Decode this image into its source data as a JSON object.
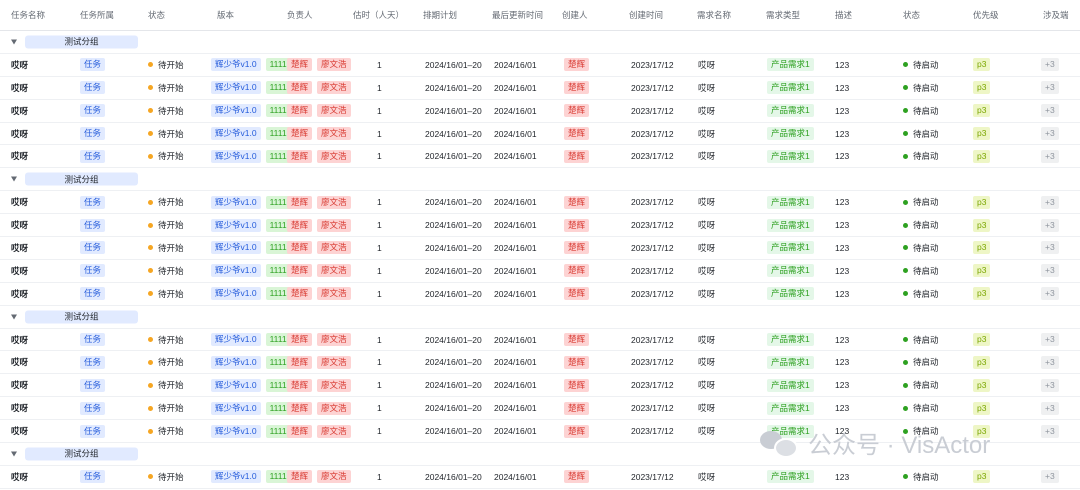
{
  "headers": [
    "任务名称",
    "任务所属",
    "状态",
    "版本",
    "负责人",
    "估时（人天）",
    "排期计划",
    "最后更新时间",
    "创建人",
    "创建时间",
    "需求名称",
    "需求类型",
    "描述",
    "状态",
    "优先级",
    "涉及端"
  ],
  "groups": [
    {
      "label": "测试分组",
      "rows": 5
    },
    {
      "label": "测试分组",
      "rows": 5
    },
    {
      "label": "测试分组",
      "rows": 5
    },
    {
      "label": "测试分组",
      "rows": 1
    }
  ],
  "row": {
    "task_name": "哎呀",
    "belongs": "任务",
    "status": "待开始",
    "version": "辉少爷v1.0",
    "version_num": "1111",
    "owner1": "楚辉",
    "owner2": "廖文浩",
    "estimate": "1",
    "schedule": "2024/16/01–20",
    "updated": "2024/16/01",
    "creator": "楚辉",
    "created": "2023/17/12",
    "req_name": "哎呀",
    "req_type": "产品需求1",
    "desc": "123",
    "status2": "待启动",
    "priority": "p3",
    "platforms": "+3"
  },
  "watermark": "公众号 · VisActor",
  "colors": {
    "group_pill": "#e1eaff",
    "status_dot": "#f5a623",
    "status2_dot": "#2ea121"
  }
}
